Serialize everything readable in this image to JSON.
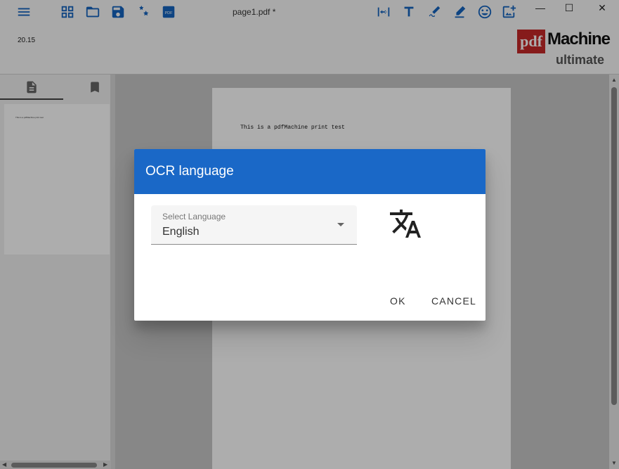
{
  "window": {
    "title": "page1.pdf *",
    "version": "20.15",
    "controls": [
      "minimize",
      "maximize",
      "close"
    ]
  },
  "toolbar": {
    "left_icons": [
      "menu-icon",
      "grid-icon",
      "folder-open-icon",
      "save-icon",
      "settings-icon",
      "pdf-icon"
    ],
    "right_icons": [
      "fit-width-icon",
      "text-icon",
      "signature-icon",
      "pen-icon",
      "emoji-icon",
      "add-image-icon"
    ]
  },
  "logo": {
    "pdf": "pdf",
    "machine": "Machine",
    "edition": "ultimate"
  },
  "sidebar": {
    "tabs": [
      "pages-icon",
      "bookmarks-icon"
    ],
    "thumbnail_text": "This is a pdfMachine print test"
  },
  "document": {
    "text": "This is a pdfMachine print test"
  },
  "dialog": {
    "title": "OCR language",
    "select": {
      "label": "Select Language",
      "value": "English"
    },
    "buttons": {
      "ok": "OK",
      "cancel": "CANCEL"
    }
  },
  "colors": {
    "accent": "#1a68c7",
    "icon": "#1565c0",
    "logo_red": "#c62828"
  }
}
